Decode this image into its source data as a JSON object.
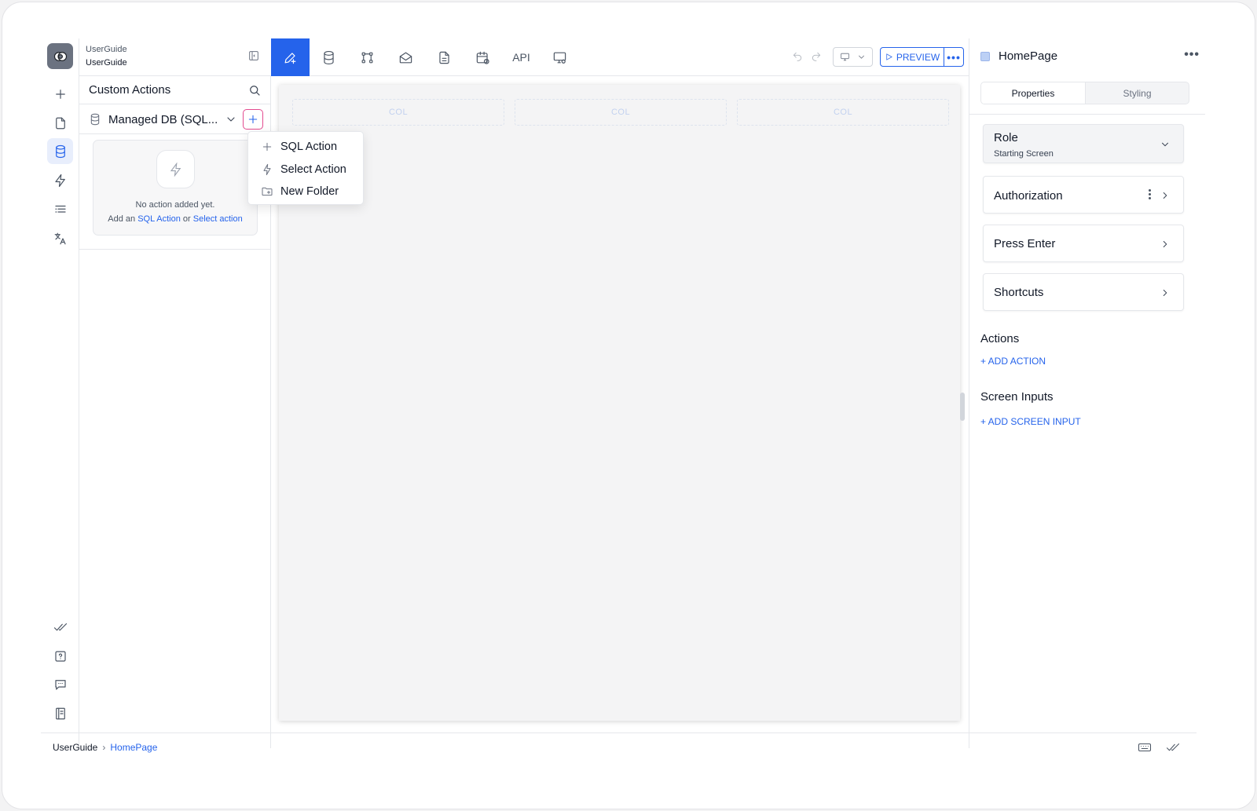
{
  "project": {
    "line1": "UserGuide",
    "line2": "UserGuide"
  },
  "left_panel": {
    "title": "Custom Actions",
    "db_selector": "Managed DB (SQL...",
    "empty": {
      "line1": "No action added yet.",
      "add_an": "Add an",
      "sql_action_link": "SQL Action",
      "or": "or",
      "select_action_link": "Select action"
    }
  },
  "menu": {
    "items": [
      {
        "label": "SQL Action",
        "icon": "plus-icon"
      },
      {
        "label": "Select Action",
        "icon": "bolt-icon"
      },
      {
        "label": "New Folder",
        "icon": "folder-plus-icon"
      }
    ]
  },
  "toolbar": {
    "api_label": "API",
    "preview_label": "PREVIEW",
    "more_label": "•••"
  },
  "canvas": {
    "cols": [
      "COL",
      "COL",
      "COL"
    ]
  },
  "right_panel": {
    "title": "HomePage",
    "more_label": "•••",
    "tabs": {
      "properties": "Properties",
      "styling": "Styling"
    },
    "role": {
      "title": "Role",
      "value": "Starting Screen"
    },
    "cards": [
      "Authorization",
      "Press Enter",
      "Shortcuts"
    ],
    "actions": {
      "title": "Actions",
      "link": "+ ADD ACTION"
    },
    "screen_inputs": {
      "title": "Screen Inputs",
      "link": "+ ADD SCREEN INPUT"
    }
  },
  "breadcrumb": {
    "root": "UserGuide",
    "separator": "›",
    "current": "HomePage"
  },
  "colors": {
    "accent": "#2563eb",
    "highlight": "#e34b8f",
    "canvas": "#f4f4f5"
  }
}
